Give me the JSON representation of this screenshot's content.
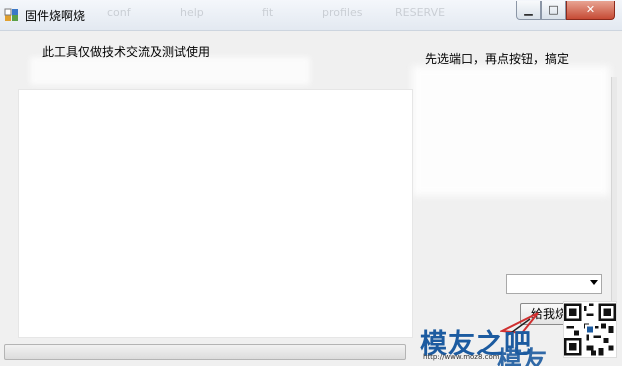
{
  "window": {
    "title": "固件烧啊烧",
    "controls": {
      "minimize": "▁",
      "maximize": "□",
      "close": "✕"
    },
    "background_menu_ghost": [
      "conf",
      "help",
      "fit",
      "profiles",
      "RESERVE"
    ]
  },
  "content": {
    "disclaimer": "此工具仅做技术交流及测试使用",
    "instruction": "先选端口，再点按钮，搞定",
    "port_select": {
      "value": ""
    },
    "burn_button": "给我烧",
    "progress": 0
  },
  "watermark": {
    "logo_text": "模友之吧",
    "url": "http://www.moz8.com",
    "logo_text_2": "模友"
  },
  "colors": {
    "window_bg": "#f0f0f0",
    "accent_close": "#c64b35",
    "watermark_blue": "#1c5ba0"
  }
}
